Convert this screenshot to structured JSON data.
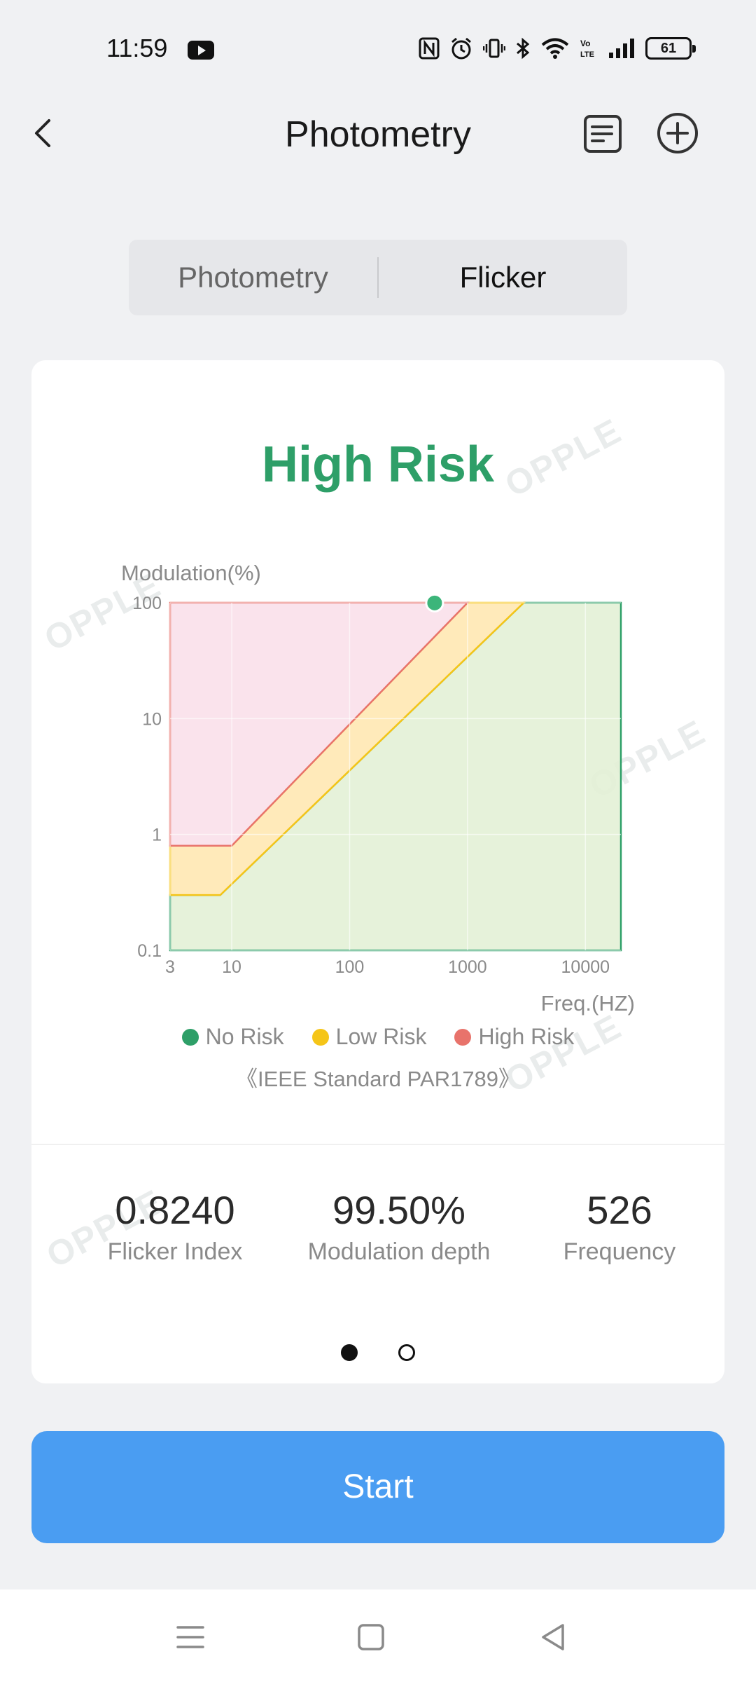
{
  "status_bar": {
    "time": "11:59",
    "battery": "61",
    "icons": [
      "youtube-icon",
      "nfc-icon",
      "alarm-icon",
      "vibrate-icon",
      "bluetooth-icon",
      "wifi-icon",
      "volte-icon",
      "signal-icon",
      "battery-icon"
    ]
  },
  "header": {
    "title": "Photometry"
  },
  "tabs": {
    "photometry": "Photometry",
    "flicker": "Flicker",
    "active": "flicker"
  },
  "card": {
    "risk_title": "High Risk",
    "risk_color": "#2e9f68",
    "watermark": "OPPLE",
    "legend": [
      {
        "label": "No Risk",
        "color": "#2e9f68"
      },
      {
        "label": "Low Risk",
        "color": "#f5c518"
      },
      {
        "label": "High Risk",
        "color": "#e8736b"
      }
    ],
    "standard": "《IEEE Standard PAR1789》",
    "metrics": {
      "flicker_index_value": "0.8240",
      "flicker_index_label": "Flicker Index",
      "modulation_value": "99.50%",
      "modulation_label": "Modulation depth",
      "frequency_value": "526",
      "frequency_label": "Frequency"
    },
    "pager": {
      "pages": 2,
      "current": 1
    }
  },
  "chart_data": {
    "type": "area",
    "xlabel": "Freq.(HZ)",
    "ylabel": "Modulation(%)",
    "x_scale": "log",
    "y_scale": "log",
    "xlim": [
      3,
      20000
    ],
    "ylim": [
      0.1,
      100
    ],
    "x_ticks": [
      "3",
      "10",
      "100",
      "1000",
      "10000"
    ],
    "y_ticks": [
      "100",
      "10",
      "1",
      "0.1"
    ],
    "series": [
      {
        "name": "No Risk",
        "color": "#2e9f68",
        "fill": "#e3f1d6",
        "boundary": [
          [
            3,
            0.1
          ],
          [
            20000,
            0.1
          ],
          [
            20000,
            100
          ],
          [
            3000,
            100
          ],
          [
            8,
            0.3
          ],
          [
            3,
            0.3
          ]
        ]
      },
      {
        "name": "Low Risk",
        "color": "#f5c518",
        "fill": "#ffe8b3",
        "boundary": [
          [
            3,
            0.3
          ],
          [
            8,
            0.3
          ],
          [
            3000,
            100
          ],
          [
            1000,
            100
          ],
          [
            10,
            0.8
          ],
          [
            3,
            0.8
          ]
        ]
      },
      {
        "name": "High Risk",
        "color": "#e8736b",
        "fill": "#f9e0ea",
        "boundary": [
          [
            3,
            0.8
          ],
          [
            10,
            0.8
          ],
          [
            1000,
            100
          ],
          [
            3,
            100
          ]
        ]
      }
    ],
    "measurement": {
      "x": 526,
      "y": 99.5,
      "color": "#3cb57a"
    },
    "grid": true
  }
}
